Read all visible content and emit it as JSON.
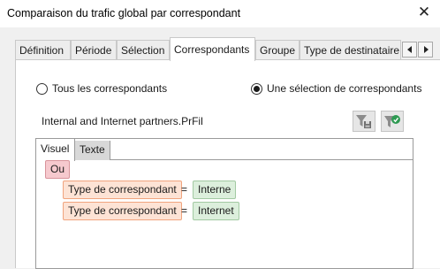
{
  "window": {
    "title": "Comparaison du trafic global par correspondant",
    "close_glyph": "✕"
  },
  "tabs": [
    {
      "label": "Définition",
      "active": false
    },
    {
      "label": "Période",
      "active": false
    },
    {
      "label": "Sélection",
      "active": false
    },
    {
      "label": "Correspondants",
      "active": true
    },
    {
      "label": "Groupe",
      "active": false
    },
    {
      "label": "Type de destinataire",
      "active": false
    }
  ],
  "tab_scroll": {
    "left_icon": "triangle-left-icon",
    "right_icon": "triangle-right-icon"
  },
  "correspondents": {
    "options": [
      {
        "label": "Tous les correspondants",
        "checked": false
      },
      {
        "label": "Une sélection de correspondants",
        "checked": true
      }
    ],
    "filter_file": "Internal and Internet partners.PrFil",
    "buttons": [
      {
        "name": "save-filter-button",
        "icon": "filter-save-icon"
      },
      {
        "name": "load-filter-button",
        "icon": "filter-load-icon"
      }
    ]
  },
  "editor": {
    "tabs": [
      {
        "label": "Visuel",
        "active": true
      },
      {
        "label": "Texte",
        "active": false
      }
    ],
    "operator": "Ou",
    "conditions": [
      {
        "field": "Type de correspondant",
        "op": "=",
        "value": "Interne"
      },
      {
        "field": "Type de correspondant",
        "op": "=",
        "value": "Internet"
      }
    ]
  },
  "colors": {
    "operator_bg": "#f6c9ce",
    "field_bg": "#fde3d5",
    "value_bg": "#dcefdc",
    "filter_icon_green": "#2e9a52"
  }
}
